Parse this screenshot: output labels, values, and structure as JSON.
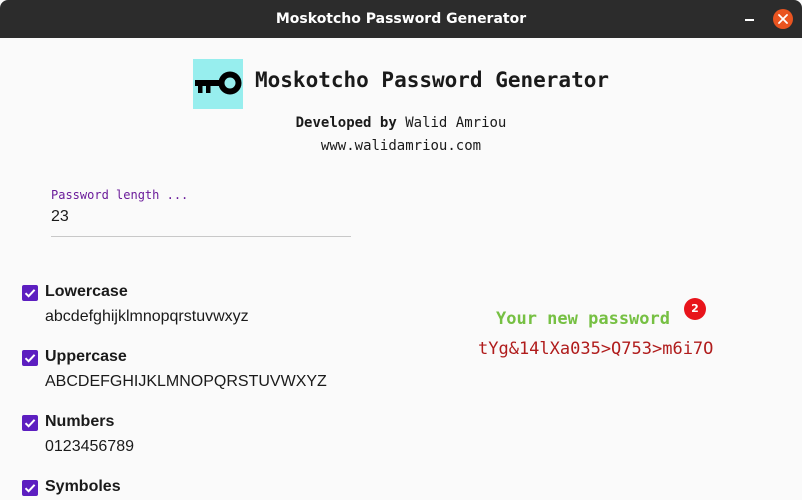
{
  "window": {
    "title": "Moskotcho Password Generator"
  },
  "header": {
    "logo_icon": "key-icon",
    "logo_bg_color": "#97eeee",
    "app_title": "Moskotcho Password Generator",
    "developed_by_label": "Developed by",
    "developer_name": "Walid Amriou",
    "website": "www.walidamriou.com"
  },
  "length_field": {
    "label": "Password length ...",
    "value": "23"
  },
  "options": [
    {
      "label": "Lowercase",
      "chars": "abcdefghijklmnopqrstuvwxyz",
      "checked": true
    },
    {
      "label": "Uppercase",
      "chars": "ABCDEFGHIJKLMNOPQRSTUVWXYZ",
      "checked": true
    },
    {
      "label": "Numbers",
      "chars": "0123456789",
      "checked": true
    },
    {
      "label": "Symboles",
      "checked": true
    }
  ],
  "result": {
    "title": "Your new password",
    "badge_count": "2",
    "password": "tYg&14lXa035>Q753>m6i7O"
  },
  "colors": {
    "accent": "#5c1ec0",
    "result_title": "#76c043",
    "password": "#b01c1c",
    "badge": "#e8141b",
    "close_button": "#e95420"
  }
}
